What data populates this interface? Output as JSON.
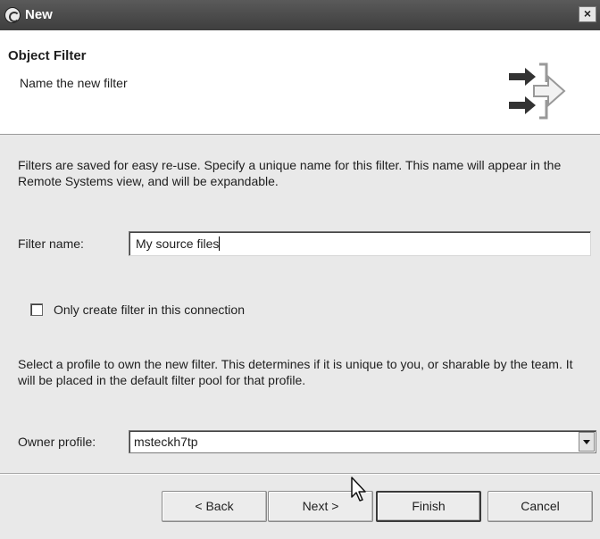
{
  "window": {
    "title": "New",
    "close_label": "×"
  },
  "banner": {
    "heading": "Object Filter",
    "subheading": "Name the new filter"
  },
  "content": {
    "description": "Filters are saved for easy re-use. Specify a unique name for this filter. This name will appear in the Remote Systems view, and will be expandable.",
    "filter_name_label": "Filter name:",
    "filter_name_value": "My source files",
    "checkbox_label": "Only create filter in this connection",
    "checkbox_checked": false,
    "profile_description": "Select a profile to own the new filter. This determines if it is unique to you, or sharable by the team. It will be placed in the default filter pool for that profile.",
    "owner_profile_label": "Owner profile:",
    "owner_profile_value": "msteckh7tp"
  },
  "buttons": {
    "back": "< Back",
    "next": "Next >",
    "finish": "Finish",
    "cancel": "Cancel"
  },
  "icons": {
    "app": "eclipse-icon",
    "wizard": "wizard-arrows-icon",
    "close": "close-icon",
    "dropdown": "chevron-down-icon",
    "cursor": "mouse-pointer-icon"
  }
}
